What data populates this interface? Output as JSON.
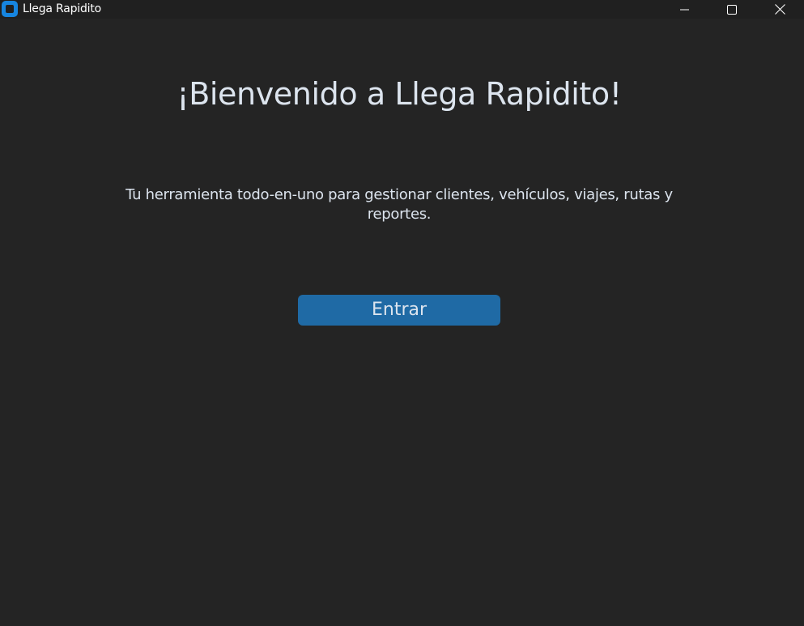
{
  "window": {
    "title": "Llega Rapidito",
    "app_icon": "app-logo-icon",
    "controls": {
      "minimize_icon": "minimize-icon",
      "maximize_icon": "maximize-icon",
      "close_icon": "close-icon"
    }
  },
  "main": {
    "heading": "¡Bienvenido a Llega Rapidito!",
    "subtitle": "Tu herramienta todo-en-uno para gestionar clientes, vehículos, viajes, rutas y reportes.",
    "enter_button_label": "Entrar"
  },
  "colors": {
    "background": "#242424",
    "titlebar": "#202020",
    "text": "#dce4ee",
    "button": "#1f6aa5",
    "app_icon": "#1685e0"
  }
}
